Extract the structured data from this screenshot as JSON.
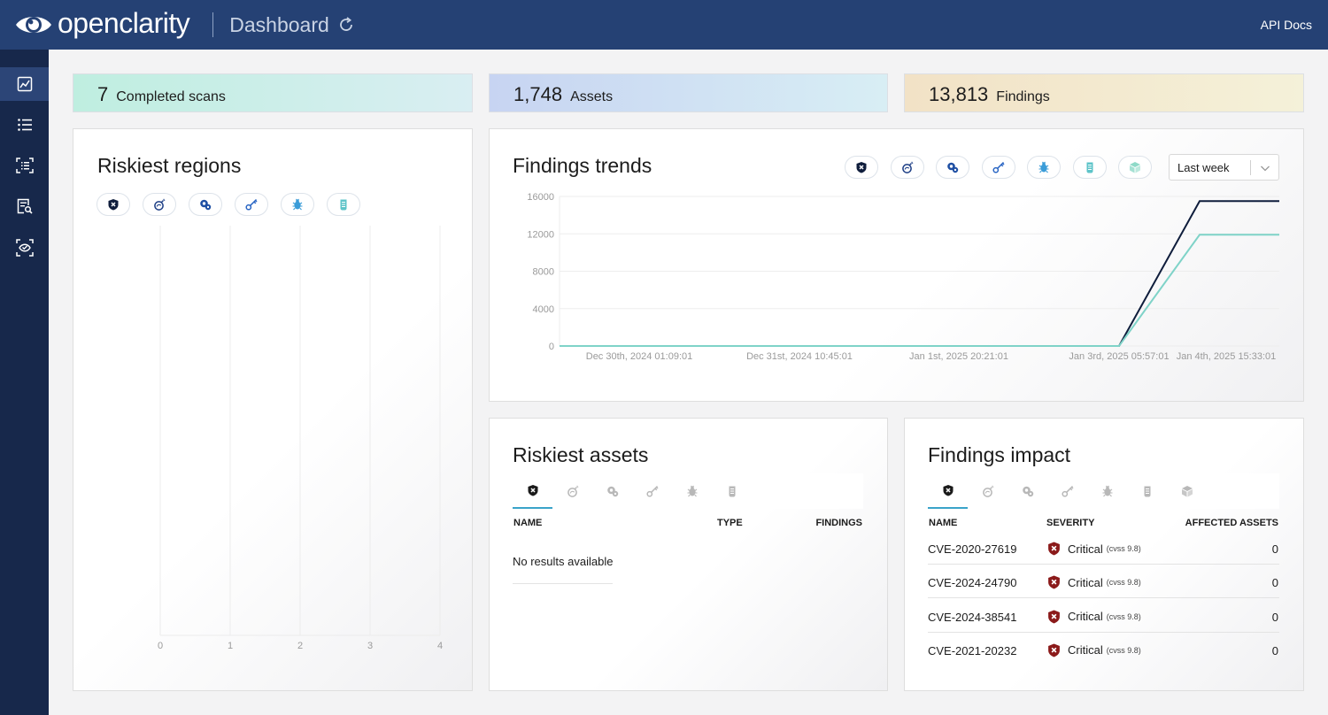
{
  "header": {
    "brand": "openclarity",
    "page_title": "Dashboard",
    "api_docs": "API Docs"
  },
  "sidebar": {
    "items": [
      {
        "name": "dashboard",
        "icon": "chart-icon",
        "active": true
      },
      {
        "name": "scans",
        "icon": "list-icon",
        "active": false
      },
      {
        "name": "assets",
        "icon": "scan-list-icon",
        "active": false
      },
      {
        "name": "findings",
        "icon": "search-document-icon",
        "active": false
      },
      {
        "name": "scan-configurations",
        "icon": "scan-eye-icon",
        "active": false
      }
    ]
  },
  "stats": {
    "scans": {
      "value": "7",
      "label": "Completed scans"
    },
    "assets": {
      "value": "1,748",
      "label": "Assets"
    },
    "findings": {
      "value": "13,813",
      "label": "Findings"
    }
  },
  "riskiest_regions": {
    "title": "Riskiest regions",
    "filters": [
      "vulnerability-icon",
      "exploit-icon",
      "misconfiguration-icon",
      "secret-icon",
      "malware-icon",
      "rootkit-icon"
    ],
    "x_ticks": [
      "0",
      "1",
      "2",
      "3",
      "4"
    ]
  },
  "findings_trends": {
    "title": "Findings trends",
    "filters": [
      "vulnerability-icon",
      "exploit-icon",
      "misconfiguration-icon",
      "secret-icon",
      "malware-icon",
      "rootkit-icon",
      "package-icon"
    ],
    "period": "Last week"
  },
  "chart_data": {
    "type": "line",
    "title": "Findings trends",
    "x": [
      "Dec 30th, 2024 01:09:01",
      "Dec 31st, 2024 10:45:01",
      "Jan 1st, 2025 20:21:01",
      "Jan 3rd, 2025 05:57:01",
      "Jan 4th, 2025 15:33:01"
    ],
    "ylim": [
      0,
      16000
    ],
    "yticks": [
      "16000",
      "12000",
      "8000",
      "4000",
      "0"
    ],
    "series_colors": [
      "#0f1d3c",
      "#7fd3c8"
    ],
    "series": [
      {
        "values": [
          0,
          0,
          0,
          0,
          15500,
          15500
        ]
      },
      {
        "values": [
          0,
          0,
          0,
          0,
          11900,
          11900
        ]
      }
    ],
    "grid": true
  },
  "riskiest_assets": {
    "title": "Riskiest assets",
    "tabs": [
      "vulnerability-icon",
      "exploit-icon",
      "misconfiguration-icon",
      "secret-icon",
      "malware-icon",
      "rootkit-icon"
    ],
    "columns": [
      "NAME",
      "TYPE",
      "FINDINGS"
    ],
    "empty": "No results available"
  },
  "findings_impact": {
    "title": "Findings impact",
    "tabs": [
      "vulnerability-icon",
      "exploit-icon",
      "misconfiguration-icon",
      "secret-icon",
      "malware-icon",
      "rootkit-icon",
      "package-icon"
    ],
    "columns": [
      "NAME",
      "SEVERITY",
      "AFFECTED ASSETS"
    ],
    "rows": [
      {
        "name": "CVE-2020-27619",
        "severity": "Critical",
        "cvss": "(cvss 9.8)",
        "affected": "0"
      },
      {
        "name": "CVE-2024-24790",
        "severity": "Critical",
        "cvss": "(cvss 9.8)",
        "affected": "0"
      },
      {
        "name": "CVE-2024-38541",
        "severity": "Critical",
        "cvss": "(cvss 9.8)",
        "affected": "0"
      },
      {
        "name": "CVE-2021-20232",
        "severity": "Critical",
        "cvss": "(cvss 9.8)",
        "affected": "0"
      }
    ]
  },
  "colors": {
    "header": "#254174",
    "sidebar": "#17284b",
    "accent": "#3aa3c9",
    "critical": "#8b1a1a"
  }
}
